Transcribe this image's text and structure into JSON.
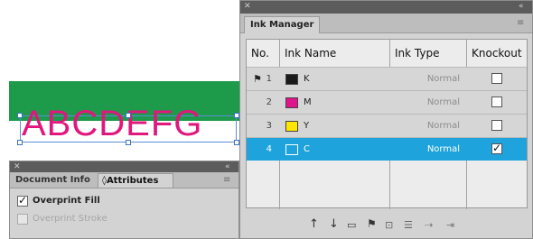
{
  "artwork": {
    "text": "ABCDEFG",
    "text_color": "#e0177d",
    "band_color": "#1d9a4a"
  },
  "doc_panel": {
    "tabs": [
      "Document Info",
      "◊Attributes"
    ],
    "active_tab": "◊Attributes",
    "options": [
      {
        "label": "Overprint Fill",
        "checked": true,
        "enabled": true
      },
      {
        "label": "Overprint Stroke",
        "checked": false,
        "enabled": false
      }
    ]
  },
  "ink_manager": {
    "title": "Ink Manager",
    "columns": [
      "No.",
      "Ink Name",
      "Ink Type",
      "Knockout"
    ],
    "rows": [
      {
        "no": "1",
        "name": "K",
        "type": "Normal",
        "knockout": false,
        "swatch": "#1a1a1a",
        "selected": false,
        "flag": true
      },
      {
        "no": "2",
        "name": "M",
        "type": "Normal",
        "knockout": false,
        "swatch": "#e0158b",
        "selected": false,
        "flag": false
      },
      {
        "no": "3",
        "name": "Y",
        "type": "Normal",
        "knockout": false,
        "swatch": "#ffe500",
        "selected": false,
        "flag": false
      },
      {
        "no": "4",
        "name": "C",
        "type": "Normal",
        "knockout": true,
        "swatch": "#1ea3dc",
        "selected": true,
        "flag": false
      }
    ],
    "footer_icons": [
      "arrow-up-icon",
      "arrow-down-icon",
      "new-ink-icon",
      "flag-icon",
      "ink-type-icon",
      "ink-list-icon",
      "unlink-icon",
      "link-icon"
    ]
  }
}
